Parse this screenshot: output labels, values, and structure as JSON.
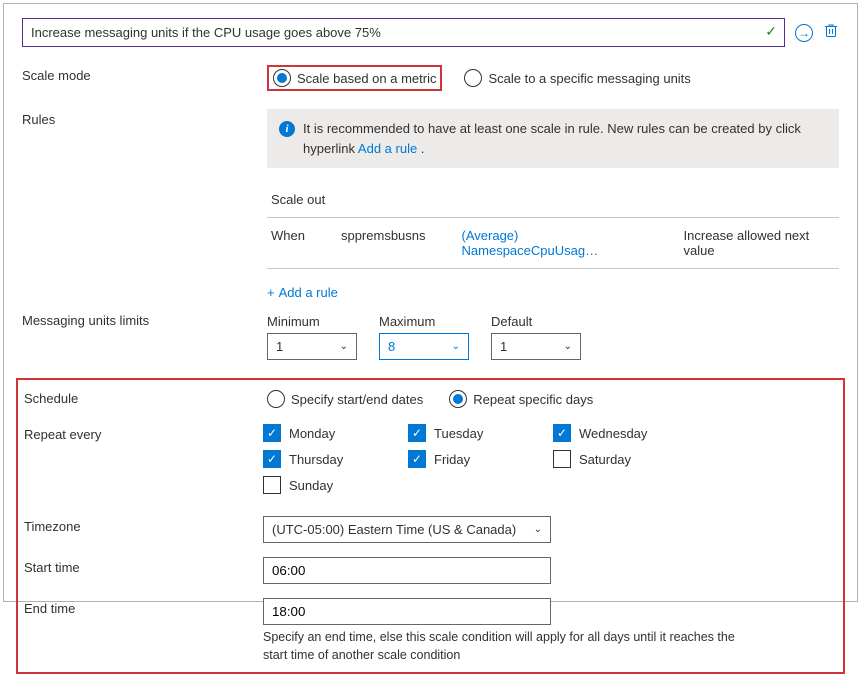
{
  "condition_name": "Increase messaging units if the CPU usage goes above 75%",
  "scale_mode": {
    "label": "Scale mode",
    "option_metric": "Scale based on a metric",
    "option_specific": "Scale to a specific messaging units"
  },
  "rules": {
    "label": "Rules",
    "info_text": "It is recommended to have at least one scale in rule. New rules can be created by click hyperlink ",
    "info_link": "Add a rule",
    "scale_out_label": "Scale out",
    "when": "When",
    "resource": "sppremsbusns",
    "metric": "(Average) NamespaceCpuUsag…",
    "action": "Increase allowed next value",
    "add_rule": "Add a rule"
  },
  "limits": {
    "label": "Messaging units limits",
    "min_label": "Minimum",
    "min_value": "1",
    "max_label": "Maximum",
    "max_value": "8",
    "def_label": "Default",
    "def_value": "1"
  },
  "schedule": {
    "label": "Schedule",
    "option_dates": "Specify start/end dates",
    "option_repeat": "Repeat specific days"
  },
  "repeat": {
    "label": "Repeat every",
    "days": {
      "monday": "Monday",
      "tuesday": "Tuesday",
      "wednesday": "Wednesday",
      "thursday": "Thursday",
      "friday": "Friday",
      "saturday": "Saturday",
      "sunday": "Sunday"
    }
  },
  "timezone": {
    "label": "Timezone",
    "value": "(UTC-05:00) Eastern Time (US & Canada)"
  },
  "start": {
    "label": "Start time",
    "value": "06:00"
  },
  "end": {
    "label": "End time",
    "value": "18:00",
    "hint": "Specify an end time, else this scale condition will apply for all days until it reaches the start time of another scale condition"
  },
  "icons": {
    "plus": "+"
  }
}
